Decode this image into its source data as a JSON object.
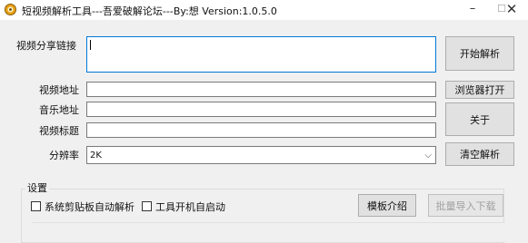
{
  "window": {
    "title": "短视频解析工具---吾爱破解论坛---By:想  Version:1.0.5.0",
    "minimize": "–",
    "maximize": "☐",
    "close": "✕"
  },
  "form": {
    "share_link_label": "视频分享链接",
    "share_link_value": "",
    "video_url_label": "视频地址",
    "video_url_value": "",
    "music_url_label": "音乐地址",
    "music_url_value": "",
    "video_title_label": "视频标题",
    "video_title_value": "",
    "resolution_label": "分辨率",
    "resolution_value": "2K"
  },
  "buttons": {
    "start_parse": "开始解析",
    "open_browser": "浏览器打开",
    "about": "关于",
    "clear_parse": "清空解析",
    "template_intro": "模板介绍",
    "batch_import": "批量导入下载"
  },
  "settings": {
    "group_title": "设置",
    "clipboard_auto_parse": "系统剪贴板自动解析",
    "clipboard_auto_parse_checked": false,
    "autostart": "工具开机自启动",
    "autostart_checked": false
  },
  "icons": {
    "app": "app-logo-icon",
    "dropdown": "chevron-down-icon"
  },
  "colors": {
    "focus_border": "#0078d7",
    "button_bg": "#e1e1e1",
    "window_bg": "#f0f0f0"
  }
}
